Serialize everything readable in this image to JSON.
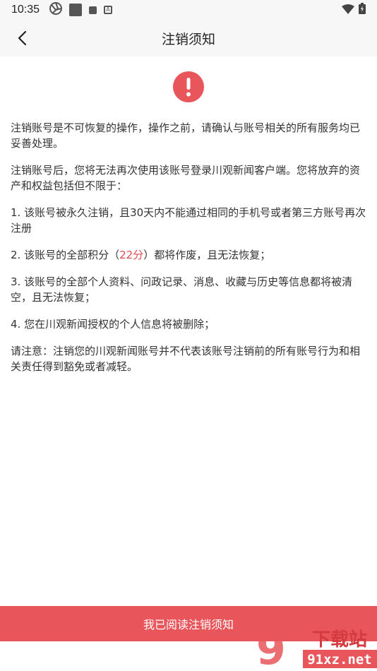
{
  "status_bar": {
    "time": "10:35",
    "a_icon": "A"
  },
  "nav": {
    "title": "注销须知"
  },
  "content": {
    "p1": "注销账号是不可恢复的操作，操作之前，请确认与账号相关的所有服务均已妥善处理。",
    "p2": "注销账号后，您将无法再次使用该账号登录川观新闻客户端。您将放弃的资产和权益包括但不限于：",
    "p3": "1. 该账号被永久注销，且30天内不能通过相同的手机号或者第三方账号再次注册",
    "p4_prefix": "2. 该账号的全部积分（",
    "p4_points": "22分",
    "p4_suffix": "）都将作废，且无法恢复；",
    "p5": "3. 该账号的全部个人资料、问政记录、消息、收藏与历史等信息都将被清空，且无法恢复；",
    "p6": "4. 您在川观新闻授权的个人信息将被删除；",
    "p7": "请注意：注销您的川观新闻账号并不代表该账号注销前的所有账号行为和相关责任得到豁免或者减轻。"
  },
  "bottom_button": {
    "label": "我已阅读注销须知"
  },
  "watermark": {
    "brand": "下载站",
    "url": "91xz.net",
    "digits": "9"
  },
  "colors": {
    "accent": "#e8555a",
    "highlight": "#e14a4f",
    "bar_bg": "#f7f7f7"
  }
}
